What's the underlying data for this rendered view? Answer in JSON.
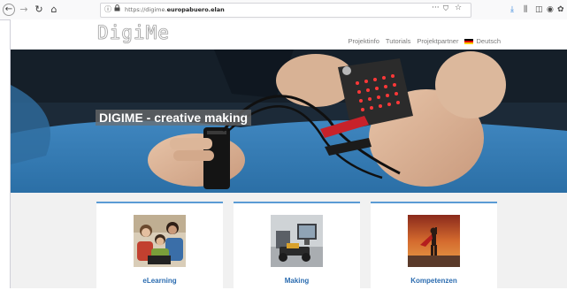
{
  "browser": {
    "url_prefix": "https://digime.",
    "url_domain": "europabuero.elan",
    "icons": [
      "back-icon",
      "forward-icon",
      "reload-icon",
      "home-icon",
      "info-icon",
      "lock-icon",
      "page-menu-icon",
      "pocket-icon",
      "star-icon",
      "download-icon",
      "library-icon",
      "sidebar-icon",
      "shield-icon",
      "extension-icon"
    ],
    "glyphs": {
      "back": "←",
      "forward": "→",
      "reload": "↻",
      "home": "⌂",
      "info": "ⓘ",
      "lock": "🔒",
      "menu": "···",
      "pocket": "⛉",
      "star": "☆",
      "download": "⤓",
      "library": "⫼",
      "sidebar": "◫",
      "shield": "◉",
      "extension": "✿"
    }
  },
  "site": {
    "logo": "DigiMe",
    "nav": [
      "Projektinfo",
      "Tutorials",
      "Projektpartner"
    ],
    "language": "Deutsch",
    "flag_colors": [
      "#000000",
      "#dd0000",
      "#ffce00"
    ]
  },
  "hero": {
    "title": "DIGIME - creative making"
  },
  "cards": [
    {
      "label": "eLearning"
    },
    {
      "label": "Making"
    },
    {
      "label": "Kompetenzen"
    }
  ],
  "colors": {
    "accent": "#2b6cb0",
    "card_rule": "#5a9bd5"
  }
}
